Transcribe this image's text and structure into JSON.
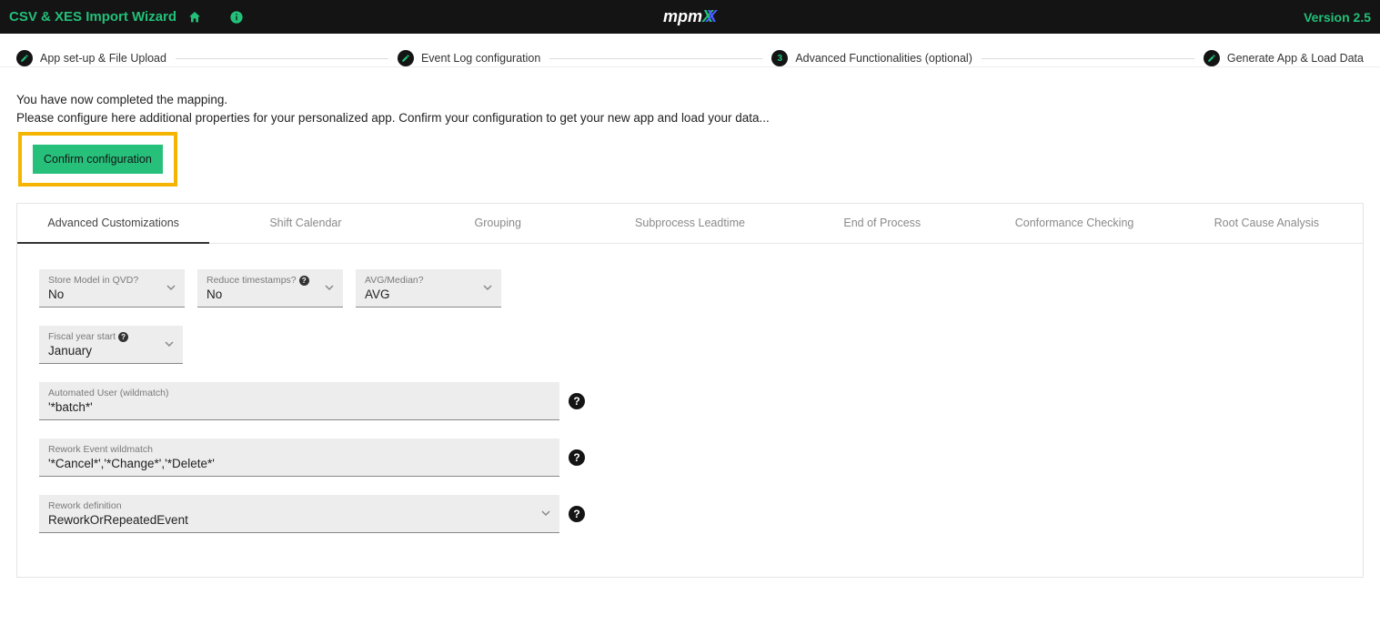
{
  "topbar": {
    "title": "CSV & XES Import Wizard",
    "version": "Version 2.5"
  },
  "stepper": {
    "steps": [
      {
        "label": "App set-up & File Upload"
      },
      {
        "label": "Event Log configuration"
      },
      {
        "label": "Advanced Functionalities (optional)",
        "badge": "3"
      },
      {
        "label": "Generate App & Load Data"
      }
    ]
  },
  "intro": {
    "line1": "You have now completed the mapping.",
    "line2": "Please configure here additional properties for your personalized app. Confirm your configuration to get your new app and load your data..."
  },
  "buttons": {
    "confirm": "Confirm configuration"
  },
  "tabs": [
    "Advanced Customizations",
    "Shift Calendar",
    "Grouping",
    "Subprocess Leadtime",
    "End of Process",
    "Conformance Checking",
    "Root Cause Analysis"
  ],
  "fields": {
    "storeModel": {
      "label": "Store Model in QVD?",
      "value": "No"
    },
    "reduceTs": {
      "label": "Reduce timestamps?",
      "value": "No"
    },
    "avgMedian": {
      "label": "AVG/Median?",
      "value": "AVG"
    },
    "fiscalYear": {
      "label": "Fiscal year start",
      "value": "January"
    },
    "autoUser": {
      "label": "Automated User (wildmatch)",
      "value": "'*batch*'"
    },
    "reworkEvt": {
      "label": "Rework Event wildmatch",
      "value": "'*Cancel*','*Change*','*Delete*'"
    },
    "reworkDef": {
      "label": "Rework definition",
      "value": "ReworkOrRepeatedEvent"
    }
  }
}
